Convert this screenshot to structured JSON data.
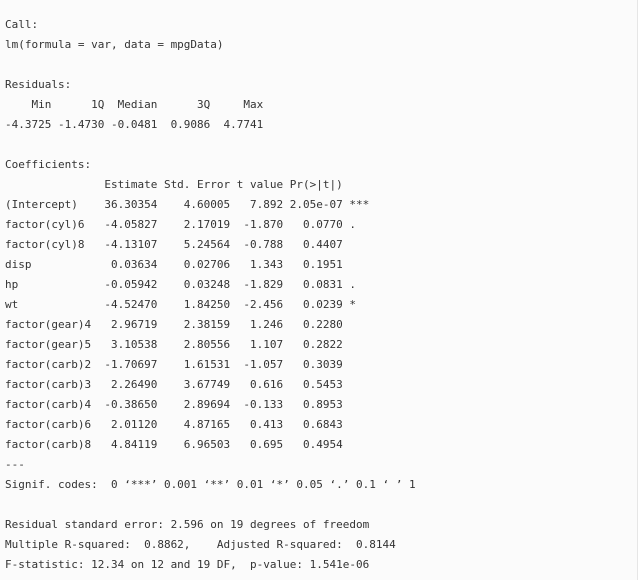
{
  "output": {
    "lines": [
      "Call:",
      "lm(formula = var, data = mpgData)",
      "",
      "Residuals:",
      "    Min      1Q  Median      3Q     Max ",
      "-4.3725 -1.4730 -0.0481  0.9086  4.7741 ",
      "",
      "Coefficients:",
      "               Estimate Std. Error t value Pr(>|t|)    ",
      "(Intercept)    36.30354    4.60005   7.892 2.05e-07 ***",
      "factor(cyl)6   -4.05827    2.17019  -1.870   0.0770 .  ",
      "factor(cyl)8   -4.13107    5.24564  -0.788   0.4407    ",
      "disp            0.03634    0.02706   1.343   0.1951    ",
      "hp             -0.05942    0.03248  -1.829   0.0831 .  ",
      "wt             -4.52470    1.84250  -2.456   0.0239 *  ",
      "factor(gear)4   2.96719    2.38159   1.246   0.2280    ",
      "factor(gear)5   3.10538    2.80556   1.107   0.2822    ",
      "factor(carb)2  -1.70697    1.61531  -1.057   0.3039    ",
      "factor(carb)3   2.26490    3.67749   0.616   0.5453    ",
      "factor(carb)4  -0.38650    2.89694  -0.133   0.8953    ",
      "factor(carb)6   2.01120    4.87165   0.413   0.6843    ",
      "factor(carb)8   4.84119    6.96503   0.695   0.4954    ",
      "---",
      "Signif. codes:  0 ‘***’ 0.001 ‘**’ 0.01 ‘*’ 0.05 ‘.’ 0.1 ‘ ’ 1",
      "",
      "Residual standard error: 2.596 on 19 degrees of freedom",
      "Multiple R-squared:  0.8862,\tAdjusted R-squared:  0.8144 ",
      "F-statistic: 12.34 on 12 and 19 DF,  p-value: 1.541e-06"
    ]
  }
}
